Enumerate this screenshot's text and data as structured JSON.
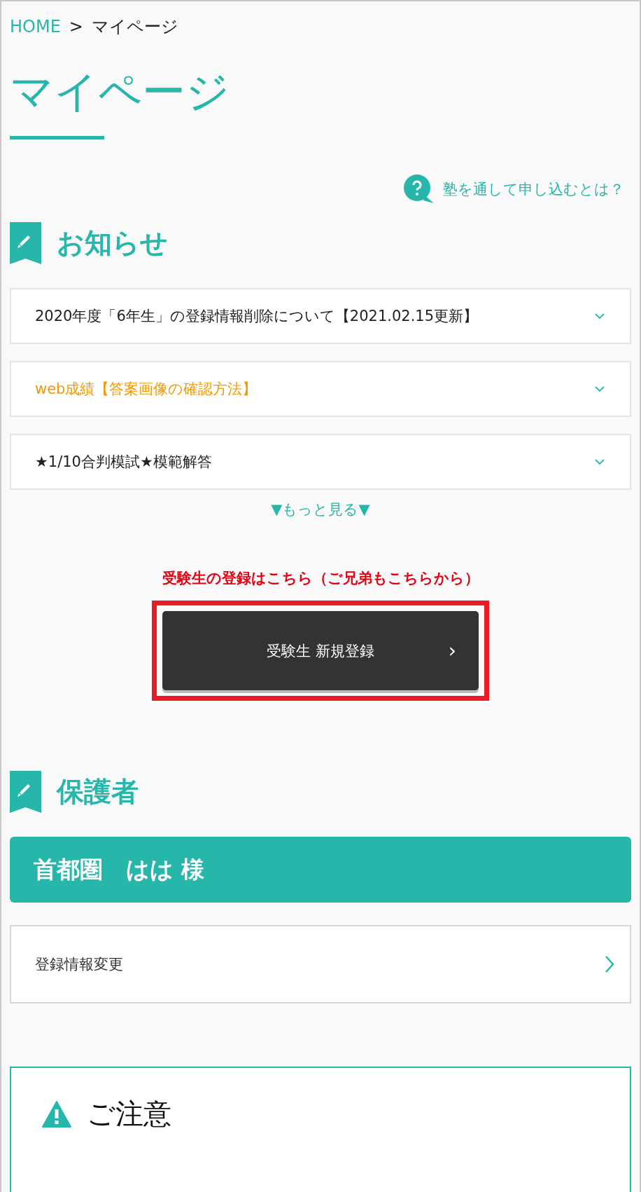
{
  "breadcrumb": {
    "home": "HOME",
    "separator": ">",
    "current": "マイページ"
  },
  "page_title": "マイページ",
  "help_link": "塾を通して申し込むとは？",
  "notices": {
    "heading": "お知らせ",
    "items": [
      {
        "title": "2020年度「6年生」の登録情報削除について【2021.02.15更新】",
        "color": "#222222",
        "expanded": false
      },
      {
        "title": "web成績【答案画像の確認方法】",
        "color": "#f39800",
        "expanded": false
      },
      {
        "title": "★1/10合判模試★模範解答",
        "color": "#222222",
        "expanded": false
      }
    ],
    "more": "▼もっと見る▼"
  },
  "register": {
    "note": "受験生の登録はこちら（ご兄弟もこちらから）",
    "button": "受験生 新規登録",
    "chevron": "›"
  },
  "guardian": {
    "heading": "保護者",
    "name": "首都圏　はは 様",
    "links": [
      "登録情報変更"
    ]
  },
  "caution": {
    "title": "ご注意"
  }
}
